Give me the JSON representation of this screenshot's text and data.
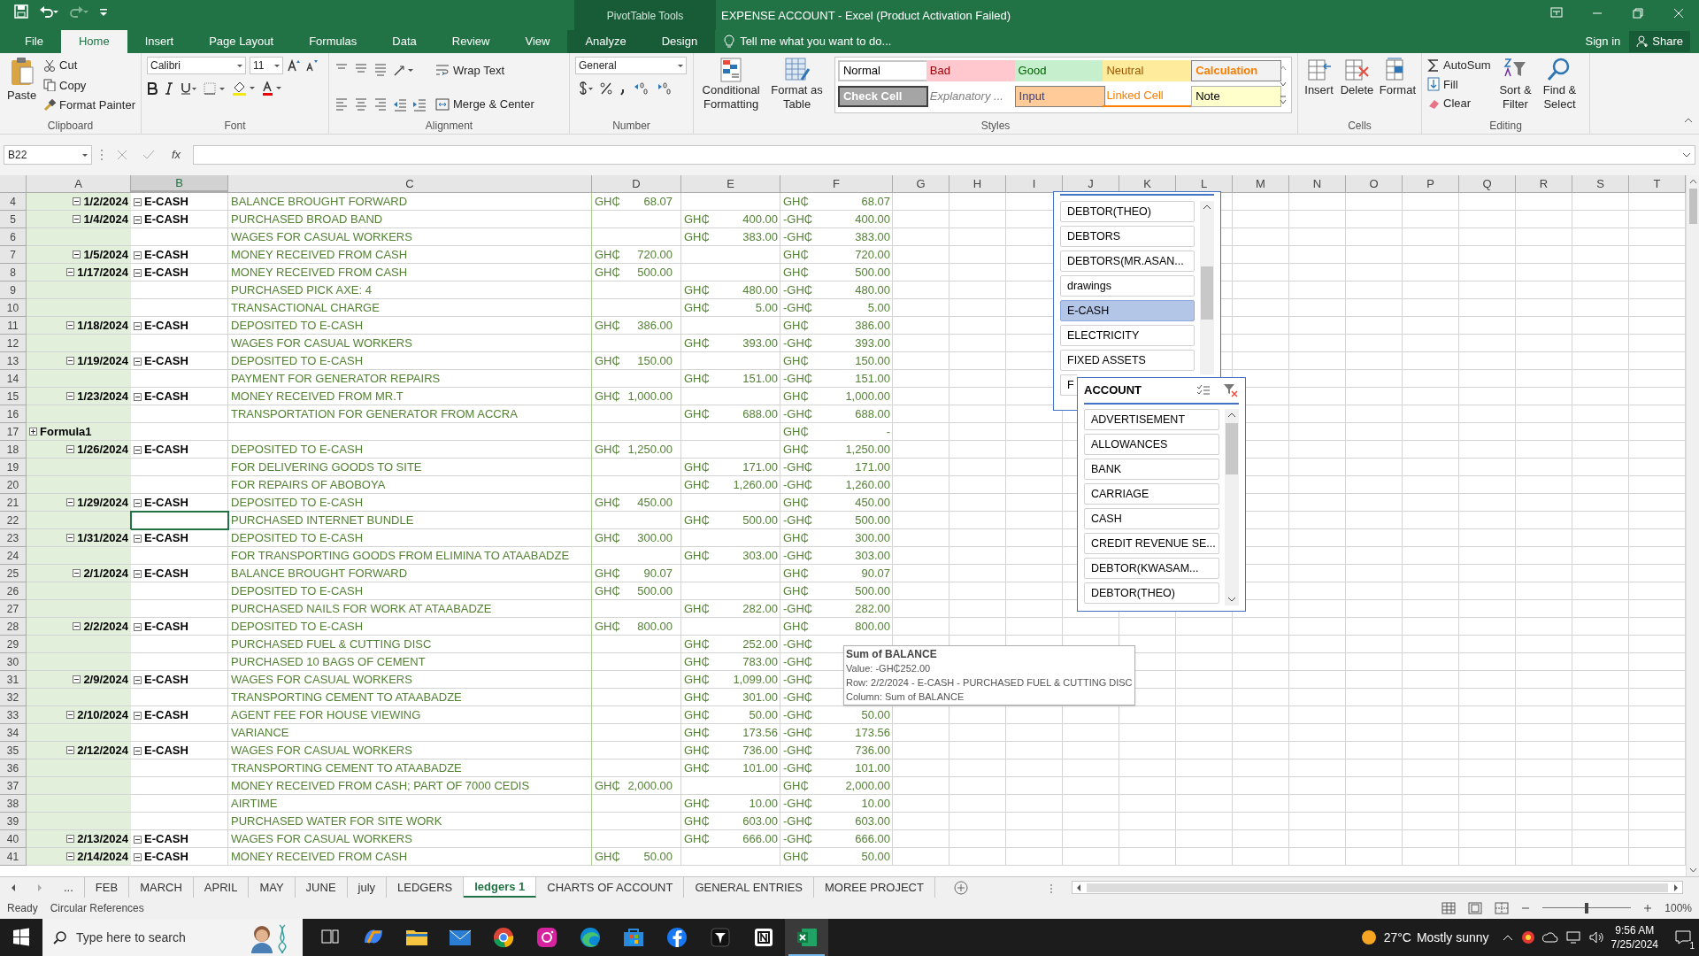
{
  "window": {
    "title": "EXPENSE ACCOUNT - Excel (Product Activation Failed)",
    "context_label": "PivotTable Tools",
    "sign_in": "Sign in",
    "share": "Share"
  },
  "ribbon_tabs": [
    {
      "label": "File",
      "selected": false,
      "contextual": false
    },
    {
      "label": "Home",
      "selected": true,
      "contextual": false
    },
    {
      "label": "Insert",
      "selected": false,
      "contextual": false
    },
    {
      "label": "Page Layout",
      "selected": false,
      "contextual": false
    },
    {
      "label": "Formulas",
      "selected": false,
      "contextual": false
    },
    {
      "label": "Data",
      "selected": false,
      "contextual": false
    },
    {
      "label": "Review",
      "selected": false,
      "contextual": false
    },
    {
      "label": "View",
      "selected": false,
      "contextual": false
    },
    {
      "label": "Analyze",
      "selected": false,
      "contextual": true
    },
    {
      "label": "Design",
      "selected": false,
      "contextual": true
    }
  ],
  "tell_me": "Tell me what you want to do...",
  "clipboard": {
    "paste": "Paste",
    "cut": "Cut",
    "copy": "Copy",
    "format_painter": "Format Painter",
    "group": "Clipboard"
  },
  "font": {
    "name": "Calibri",
    "size": "11",
    "group": "Font"
  },
  "alignment": {
    "wrap": "Wrap Text",
    "merge": "Merge & Center",
    "group": "Alignment"
  },
  "number": {
    "format": "General",
    "group": "Number"
  },
  "styles": {
    "conditional": "Conditional Formatting",
    "format_table": "Format as Table",
    "group": "Styles",
    "cells": [
      {
        "label": "Normal",
        "kind": "normal"
      },
      {
        "label": "Bad",
        "kind": "bad"
      },
      {
        "label": "Good",
        "kind": "good"
      },
      {
        "label": "Neutral",
        "kind": "neutral"
      },
      {
        "label": "Calculation",
        "kind": "calculation"
      },
      {
        "label": "Check Cell",
        "kind": "check"
      },
      {
        "label": "Explanatory ...",
        "kind": "explanatory"
      },
      {
        "label": "Input",
        "kind": "input"
      },
      {
        "label": "Linked Cell",
        "kind": "linked"
      },
      {
        "label": "Note",
        "kind": "note"
      }
    ]
  },
  "cells_group": {
    "insert": "Insert",
    "delete": "Delete",
    "format": "Format",
    "group": "Cells"
  },
  "editing": {
    "autosum": "AutoSum",
    "fill": "Fill",
    "clear": "Clear",
    "sort": "Sort & Filter",
    "find": "Find & Select",
    "group": "Editing"
  },
  "formula_bar": {
    "name_box": "B22",
    "function_label": "fx"
  },
  "columns": [
    {
      "label": "A",
      "selected": false
    },
    {
      "label": "B",
      "selected": true
    },
    {
      "label": "C",
      "selected": false
    },
    {
      "label": "D",
      "selected": false
    },
    {
      "label": "E",
      "selected": false
    },
    {
      "label": "F",
      "selected": false
    },
    {
      "label": "G",
      "selected": false
    },
    {
      "label": "H",
      "selected": false
    },
    {
      "label": "I",
      "selected": false
    },
    {
      "label": "J",
      "selected": false
    },
    {
      "label": "K",
      "selected": false
    },
    {
      "label": "L",
      "selected": false
    },
    {
      "label": "M",
      "selected": false
    },
    {
      "label": "N",
      "selected": false
    },
    {
      "label": "O",
      "selected": false
    },
    {
      "label": "P",
      "selected": false
    },
    {
      "label": "Q",
      "selected": false
    },
    {
      "label": "R",
      "selected": false
    },
    {
      "label": "S",
      "selected": false
    },
    {
      "label": "T",
      "selected": false
    }
  ],
  "rows": [
    {
      "n": "4",
      "date": "1/2/2024",
      "account": "E-CASH",
      "expanded": true,
      "desc": "BALANCE BROUGHT FORWARD",
      "debit": [
        "GH₵",
        "68.07"
      ],
      "balance": [
        "GH₵",
        "68.07"
      ]
    },
    {
      "n": "5",
      "date": "1/4/2024",
      "account": "E-CASH",
      "expanded": true,
      "desc": "PURCHASED BROAD BAND",
      "credit": [
        "GH₵",
        "400.00"
      ],
      "balance": [
        "-GH₵",
        "400.00"
      ]
    },
    {
      "n": "6",
      "desc": "WAGES FOR CASUAL WORKERS",
      "credit": [
        "GH₵",
        "383.00"
      ],
      "balance": [
        "-GH₵",
        "383.00"
      ]
    },
    {
      "n": "7",
      "date": "1/5/2024",
      "account": "E-CASH",
      "expanded": true,
      "desc": "MONEY RECEIVED FROM CASH",
      "debit": [
        "GH₵",
        "720.00"
      ],
      "balance": [
        "GH₵",
        "720.00"
      ]
    },
    {
      "n": "8",
      "date": "1/17/2024",
      "account": "E-CASH",
      "expanded": true,
      "desc": "MONEY RECEIVED FROM CASH",
      "debit": [
        "GH₵",
        "500.00"
      ],
      "balance": [
        "GH₵",
        "500.00"
      ]
    },
    {
      "n": "9",
      "desc": "PURCHASED PICK AXE: 4",
      "credit": [
        "GH₵",
        "480.00"
      ],
      "balance": [
        "-GH₵",
        "480.00"
      ]
    },
    {
      "n": "10",
      "desc": "TRANSACTIONAL CHARGE",
      "credit": [
        "GH₵",
        "5.00"
      ],
      "balance": [
        "-GH₵",
        "5.00"
      ]
    },
    {
      "n": "11",
      "date": "1/18/2024",
      "account": "E-CASH",
      "expanded": true,
      "desc": "DEPOSITED TO E-CASH",
      "debit": [
        "GH₵",
        "386.00"
      ],
      "balance": [
        "GH₵",
        "386.00"
      ]
    },
    {
      "n": "12",
      "desc": "WAGES FOR CASUAL WORKERS",
      "credit": [
        "GH₵",
        "393.00"
      ],
      "balance": [
        "-GH₵",
        "393.00"
      ]
    },
    {
      "n": "13",
      "date": "1/19/2024",
      "account": "E-CASH",
      "expanded": true,
      "desc": "DEPOSITED TO E-CASH",
      "debit": [
        "GH₵",
        "150.00"
      ],
      "balance": [
        "GH₵",
        "150.00"
      ]
    },
    {
      "n": "14",
      "desc": "PAYMENT FOR GENERATOR REPAIRS",
      "credit": [
        "GH₵",
        "151.00"
      ],
      "balance": [
        "-GH₵",
        "151.00"
      ]
    },
    {
      "n": "15",
      "date": "1/23/2024",
      "account": "E-CASH",
      "expanded": true,
      "desc": "MONEY RECEIVED FROM MR.T",
      "debit": [
        "GH₵",
        "1,000.00"
      ],
      "balance": [
        "GH₵",
        "1,000.00"
      ]
    },
    {
      "n": "16",
      "desc": "TRANSPORTATION FOR GENERATOR FROM ACCRA",
      "credit": [
        "GH₵",
        "688.00"
      ],
      "balance": [
        "-GH₵",
        "688.00"
      ]
    },
    {
      "n": "17",
      "group": "Formula1",
      "expanded": false,
      "balance": [
        "GH₵",
        "-"
      ]
    },
    {
      "n": "18",
      "date": "1/26/2024",
      "account": "E-CASH",
      "expanded": true,
      "desc": "DEPOSITED TO E-CASH",
      "debit": [
        "GH₵",
        "1,250.00"
      ],
      "balance": [
        "GH₵",
        "1,250.00"
      ]
    },
    {
      "n": "19",
      "desc": "FOR DELIVERING GOODS TO SITE",
      "credit": [
        "GH₵",
        "171.00"
      ],
      "balance": [
        "-GH₵",
        "171.00"
      ]
    },
    {
      "n": "20",
      "desc": "FOR REPAIRS  OF ABOBOYA",
      "credit": [
        "GH₵",
        "1,260.00"
      ],
      "balance": [
        "-GH₵",
        "1,260.00"
      ]
    },
    {
      "n": "21",
      "date": "1/29/2024",
      "account": "E-CASH",
      "expanded": true,
      "desc": "DEPOSITED TO E-CASH",
      "debit": [
        "GH₵",
        "450.00"
      ],
      "balance": [
        "GH₵",
        "450.00"
      ]
    },
    {
      "n": "22",
      "desc": "PURCHASED INTERNET BUNDLE",
      "credit": [
        "GH₵",
        "500.00"
      ],
      "balance": [
        "-GH₵",
        "500.00"
      ],
      "active_cell": true
    },
    {
      "n": "23",
      "date": "1/31/2024",
      "account": "E-CASH",
      "expanded": true,
      "desc": "DEPOSITED TO E-CASH",
      "debit": [
        "GH₵",
        "300.00"
      ],
      "balance": [
        "GH₵",
        "300.00"
      ]
    },
    {
      "n": "24",
      "desc": "FOR TRANSPORTING GOODS FROM ELIMINA TO ATAABADZE",
      "credit": [
        "GH₵",
        "303.00"
      ],
      "balance": [
        "-GH₵",
        "303.00"
      ]
    },
    {
      "n": "25",
      "date": "2/1/2024",
      "account": "E-CASH",
      "expanded": true,
      "desc": "BALANCE BROUGHT FORWARD",
      "debit": [
        "GH₵",
        "90.07"
      ],
      "balance": [
        "GH₵",
        "90.07"
      ]
    },
    {
      "n": "26",
      "desc": "DEPOSITED TO E-CASH",
      "debit": [
        "GH₵",
        "500.00"
      ],
      "balance": [
        "GH₵",
        "500.00"
      ]
    },
    {
      "n": "27",
      "desc": "PURCHASED NAILS FOR WORK AT ATAABADZE",
      "credit": [
        "GH₵",
        "282.00"
      ],
      "balance": [
        "-GH₵",
        "282.00"
      ]
    },
    {
      "n": "28",
      "date": "2/2/2024",
      "account": "E-CASH",
      "expanded": true,
      "desc": "DEPOSITED TO E-CASH",
      "debit": [
        "GH₵",
        "800.00"
      ],
      "balance": [
        "GH₵",
        "800.00"
      ]
    },
    {
      "n": "29",
      "desc": "PURCHASED FUEL & CUTTING DISC",
      "credit": [
        "GH₵",
        "252.00"
      ],
      "balance": [
        "-GH₵"
      ]
    },
    {
      "n": "30",
      "desc": "PURCHASED 10 BAGS OF CEMENT",
      "credit": [
        "GH₵",
        "783.00"
      ],
      "balance": [
        "-GH₵"
      ]
    },
    {
      "n": "31",
      "date": "2/9/2024",
      "account": "E-CASH",
      "expanded": true,
      "desc": "WAGES FOR CASUAL WORKERS",
      "credit": [
        "GH₵",
        "1,099.00"
      ],
      "balance": [
        "-GH₵"
      ]
    },
    {
      "n": "32",
      "desc": "TRANSPORTING CEMENT TO ATAABADZE",
      "credit": [
        "GH₵",
        "301.00"
      ],
      "balance": [
        "-GH₵"
      ]
    },
    {
      "n": "33",
      "date": "2/10/2024",
      "account": "E-CASH",
      "expanded": true,
      "desc": "AGENT FEE FOR HOUSE VIEWING",
      "credit": [
        "GH₵",
        "50.00"
      ],
      "balance": [
        "-GH₵",
        "50.00"
      ]
    },
    {
      "n": "34",
      "desc": "VARIANCE",
      "credit": [
        "GH₵",
        "173.56"
      ],
      "balance": [
        "-GH₵",
        "173.56"
      ]
    },
    {
      "n": "35",
      "date": "2/12/2024",
      "account": "E-CASH",
      "expanded": true,
      "desc": "WAGES FOR CASUAL WORKERS",
      "credit": [
        "GH₵",
        "736.00"
      ],
      "balance": [
        "-GH₵",
        "736.00"
      ]
    },
    {
      "n": "36",
      "desc": "TRANSPORTING CEMENT TO ATAABADZE",
      "credit": [
        "GH₵",
        "101.00"
      ],
      "balance": [
        "-GH₵",
        "101.00"
      ]
    },
    {
      "n": "37",
      "desc": "MONEY RECEIVED FROM CASH; PART OF 7000 CEDIS",
      "debit": [
        "GH₵",
        "2,000.00"
      ],
      "balance": [
        "GH₵",
        "2,000.00"
      ]
    },
    {
      "n": "38",
      "desc": "AIRTIME",
      "credit": [
        "GH₵",
        "10.00"
      ],
      "balance": [
        "-GH₵",
        "10.00"
      ]
    },
    {
      "n": "39",
      "desc": "PURCHASED WATER FOR SITE WORK",
      "credit": [
        "GH₵",
        "603.00"
      ],
      "balance": [
        "-GH₵",
        "603.00"
      ]
    },
    {
      "n": "40",
      "date": "2/13/2024",
      "account": "E-CASH",
      "expanded": true,
      "desc": "WAGES FOR CASUAL WORKERS",
      "credit": [
        "GH₵",
        "666.00"
      ],
      "balance": [
        "-GH₵",
        "666.00"
      ]
    },
    {
      "n": "41",
      "date": "2/14/2024",
      "account": "E-CASH",
      "expanded": true,
      "desc": "MONEY RECEIVED FROM CASH",
      "debit": [
        "GH₵",
        "50.00"
      ],
      "balance": [
        "GH₵",
        "50.00"
      ]
    }
  ],
  "slicers": [
    {
      "items": [
        {
          "label": "DEBTOR(THEO)",
          "selected": false
        },
        {
          "label": "DEBTORS",
          "selected": false
        },
        {
          "label": "DEBTORS(MR.ASAN...",
          "selected": false
        },
        {
          "label": "drawings",
          "selected": false
        },
        {
          "label": "E-CASH",
          "selected": true
        },
        {
          "label": "ELECTRICITY",
          "selected": false
        },
        {
          "label": "FIXED ASSETS",
          "selected": false
        },
        {
          "label": "F",
          "selected": false
        }
      ]
    },
    {
      "title": "ACCOUNT",
      "items": [
        {
          "label": "ADVERTISEMENT",
          "selected": false
        },
        {
          "label": "ALLOWANCES",
          "selected": false
        },
        {
          "label": "BANK",
          "selected": false
        },
        {
          "label": "CARRIAGE",
          "selected": false
        },
        {
          "label": "CASH",
          "selected": false
        },
        {
          "label": "CREDIT REVENUE SE...",
          "selected": false
        },
        {
          "label": "DEBTOR(KWASAM...",
          "selected": false
        },
        {
          "label": "DEBTOR(THEO)",
          "selected": false
        }
      ]
    }
  ],
  "tooltip": {
    "title": "Sum of BALANCE",
    "lines": [
      "Value: -GH₵252.00",
      "Row: 2/2/2024 - E-CASH - PURCHASED FUEL & CUTTING DISC",
      "Column: Sum of BALANCE"
    ]
  },
  "sheet_tabs": [
    {
      "label": "...",
      "selected": false
    },
    {
      "label": "FEB",
      "selected": false
    },
    {
      "label": "MARCH",
      "selected": false
    },
    {
      "label": "APRIL",
      "selected": false
    },
    {
      "label": "MAY",
      "selected": false
    },
    {
      "label": "JUNE",
      "selected": false
    },
    {
      "label": "july",
      "selected": false
    },
    {
      "label": "LEDGERS",
      "selected": false
    },
    {
      "label": "ledgers 1",
      "selected": true
    },
    {
      "label": "CHARTS OF ACCOUNT",
      "selected": false
    },
    {
      "label": "GENERAL ENTRIES",
      "selected": false
    },
    {
      "label": "MOREE PROJECT",
      "selected": false
    }
  ],
  "status_bar": {
    "mode": "Ready",
    "note": "Circular References",
    "zoom": "100%",
    "zoom_slider": {
      "level": 0.5
    }
  },
  "taskbar": {
    "search": "Type here to search",
    "apps": [
      {
        "kind": "taskview",
        "active": false
      },
      {
        "kind": "copilot",
        "active": false
      },
      {
        "kind": "folder",
        "active": false
      },
      {
        "kind": "mail",
        "active": false
      },
      {
        "kind": "chrome",
        "active": false
      },
      {
        "kind": "instagram",
        "active": false
      },
      {
        "kind": "edge",
        "active": false
      },
      {
        "kind": "store",
        "active": false
      },
      {
        "kind": "facebook",
        "active": false
      },
      {
        "kind": "dark",
        "active": false
      },
      {
        "kind": "notion",
        "active": false
      },
      {
        "kind": "excel",
        "active": true
      }
    ],
    "temperature": "27°C",
    "weather": "Mostly sunny",
    "time": "9:56 AM",
    "date": "7/25/2024",
    "notifications": "1"
  }
}
